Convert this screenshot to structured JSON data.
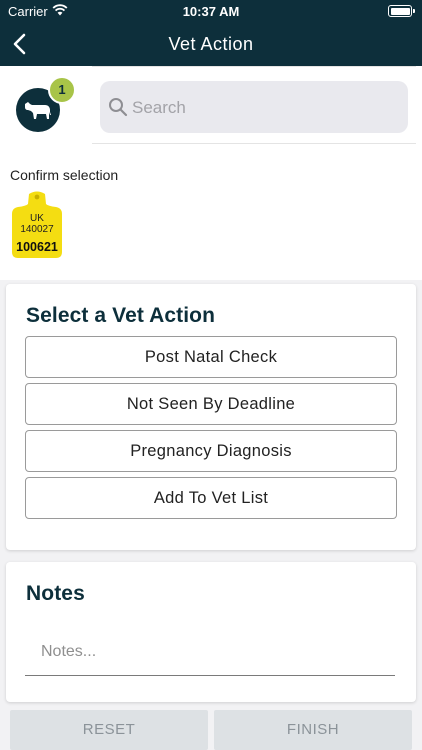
{
  "status_bar": {
    "carrier": "Carrier",
    "time": "10:37 AM"
  },
  "nav": {
    "title": "Vet Action"
  },
  "selection": {
    "count": "1",
    "search_placeholder": "Search",
    "confirm_label": "Confirm selection",
    "tag": {
      "country": "UK",
      "herd": "140027",
      "number": "100621",
      "color": "#f4dd12"
    }
  },
  "vet_actions": {
    "title": "Select a Vet Action",
    "items": [
      "Post Natal Check",
      "Not Seen By Deadline",
      "Pregnancy Diagnosis",
      "Add To Vet List"
    ]
  },
  "notes": {
    "title": "Notes",
    "placeholder": "Notes..."
  },
  "footer": {
    "reset_label": "RESET",
    "finish_label": "FINISH"
  },
  "colors": {
    "primary": "#0d2f3b",
    "badge": "#a8c448",
    "footer_bg": "#dde1e4"
  }
}
